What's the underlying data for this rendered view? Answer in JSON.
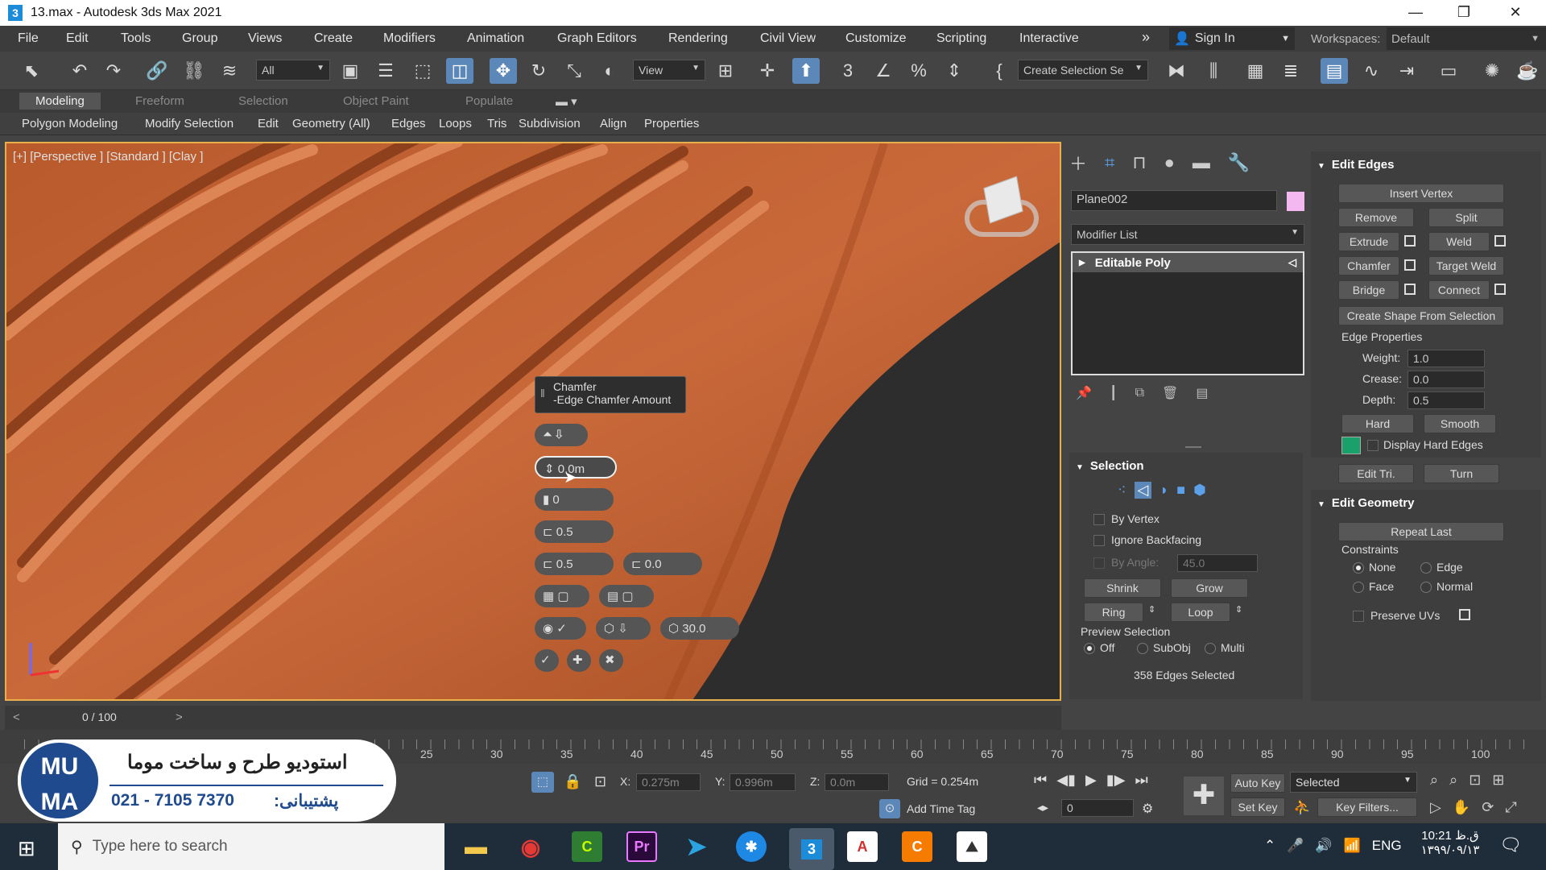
{
  "window": {
    "title": "13.max - Autodesk 3ds Max 2021",
    "app_icon": "3",
    "controls": [
      "—",
      "❐",
      "✕"
    ]
  },
  "menu": {
    "items": [
      "File",
      "Edit",
      "Tools",
      "Group",
      "Views",
      "Create",
      "Modifiers",
      "Animation",
      "Graph Editors",
      "Rendering",
      "Civil View",
      "Customize",
      "Scripting",
      "Interactive"
    ],
    "overflow": "»",
    "sign_in": "Sign In",
    "workspaces_label": "Workspaces:",
    "workspace_value": "Default"
  },
  "toolbar": {
    "selection_filter": "All",
    "ref_coord": "View",
    "named_selection": "Create Selection Se"
  },
  "ribbon": {
    "tabs": [
      "Modeling",
      "Freeform",
      "Selection",
      "Object Paint",
      "Populate"
    ],
    "active_tab": "Modeling",
    "sub_items": [
      "Polygon Modeling",
      "Modify Selection",
      "Edit",
      "Geometry (All)",
      "Edges",
      "Loops",
      "Tris",
      "Subdivision",
      "Align",
      "Properties"
    ]
  },
  "viewport": {
    "label": "[+] [Perspective ] [Standard ] [Clay ]",
    "caddy": {
      "title": "Chamfer",
      "subtitle": "-Edge Chamfer Amount",
      "amount": "0.0m",
      "segments": "0",
      "tension": "0.5",
      "depth": "0.5",
      "inset": "0.0",
      "threshold": "30.0"
    }
  },
  "command_panel": {
    "object_name": "Plane002",
    "object_color": "#f4b8f0",
    "modifier_list": "Modifier List",
    "stack": [
      "Editable Poly"
    ],
    "selection": {
      "header": "Selection",
      "by_vertex": "By Vertex",
      "ignore_backfacing": "Ignore Backfacing",
      "by_angle": "By Angle:",
      "angle_value": "45.0",
      "shrink": "Shrink",
      "grow": "Grow",
      "ring": "Ring",
      "loop": "Loop",
      "preview_label": "Preview Selection",
      "preview_off": "Off",
      "preview_subobj": "SubObj",
      "preview_multi": "Multi",
      "status": "358 Edges Selected"
    },
    "edit_edges": {
      "header": "Edit Edges",
      "insert_vertex": "Insert Vertex",
      "remove": "Remove",
      "split": "Split",
      "extrude": "Extrude",
      "weld": "Weld",
      "chamfer": "Chamfer",
      "target_weld": "Target Weld",
      "bridge": "Bridge",
      "connect": "Connect",
      "create_shape": "Create Shape From Selection",
      "edge_properties": "Edge Properties",
      "weight_label": "Weight:",
      "weight": "1.0",
      "crease_label": "Crease:",
      "crease": "0.0",
      "depth_label": "Depth:",
      "depth": "0.5",
      "hard": "Hard",
      "smooth": "Smooth",
      "display_hard_edges": "Display Hard Edges",
      "hard_edge_color": "#1aa06a",
      "edit_tri": "Edit Tri.",
      "turn": "Turn"
    },
    "edit_geometry": {
      "header": "Edit Geometry",
      "repeat_last": "Repeat Last",
      "constraints": "Constraints",
      "none": "None",
      "edge": "Edge",
      "face": "Face",
      "normal": "Normal",
      "preserve_uvs": "Preserve UVs"
    }
  },
  "timeline": {
    "frame_display": "0 / 100",
    "ticks": [
      "25",
      "30",
      "35",
      "40",
      "45",
      "50",
      "55",
      "60",
      "65",
      "70",
      "75",
      "80",
      "85",
      "90",
      "95",
      "100"
    ]
  },
  "status": {
    "x_label": "X:",
    "x": "0.275m",
    "y_label": "Y:",
    "y": "0.996m",
    "z_label": "Z:",
    "z": "0.0m",
    "grid": "Grid = 0.254m",
    "add_time_tag": "Add Time Tag",
    "auto_key": "Auto Key",
    "selected": "Selected",
    "set_key": "Set Key",
    "key_filters": "Key Filters...",
    "frame": "0"
  },
  "watermark": {
    "logo": "MU MA",
    "line1": "استودیو طرح و ساخت موما",
    "phone": "021 - 7105 7370",
    "support": "پشتیبانی:"
  },
  "taskbar": {
    "search_placeholder": "Type here to search",
    "lang": "ENG",
    "time": "10:21 ق.ظ",
    "date": "۱۳۹۹/۰۹/۱۳"
  }
}
